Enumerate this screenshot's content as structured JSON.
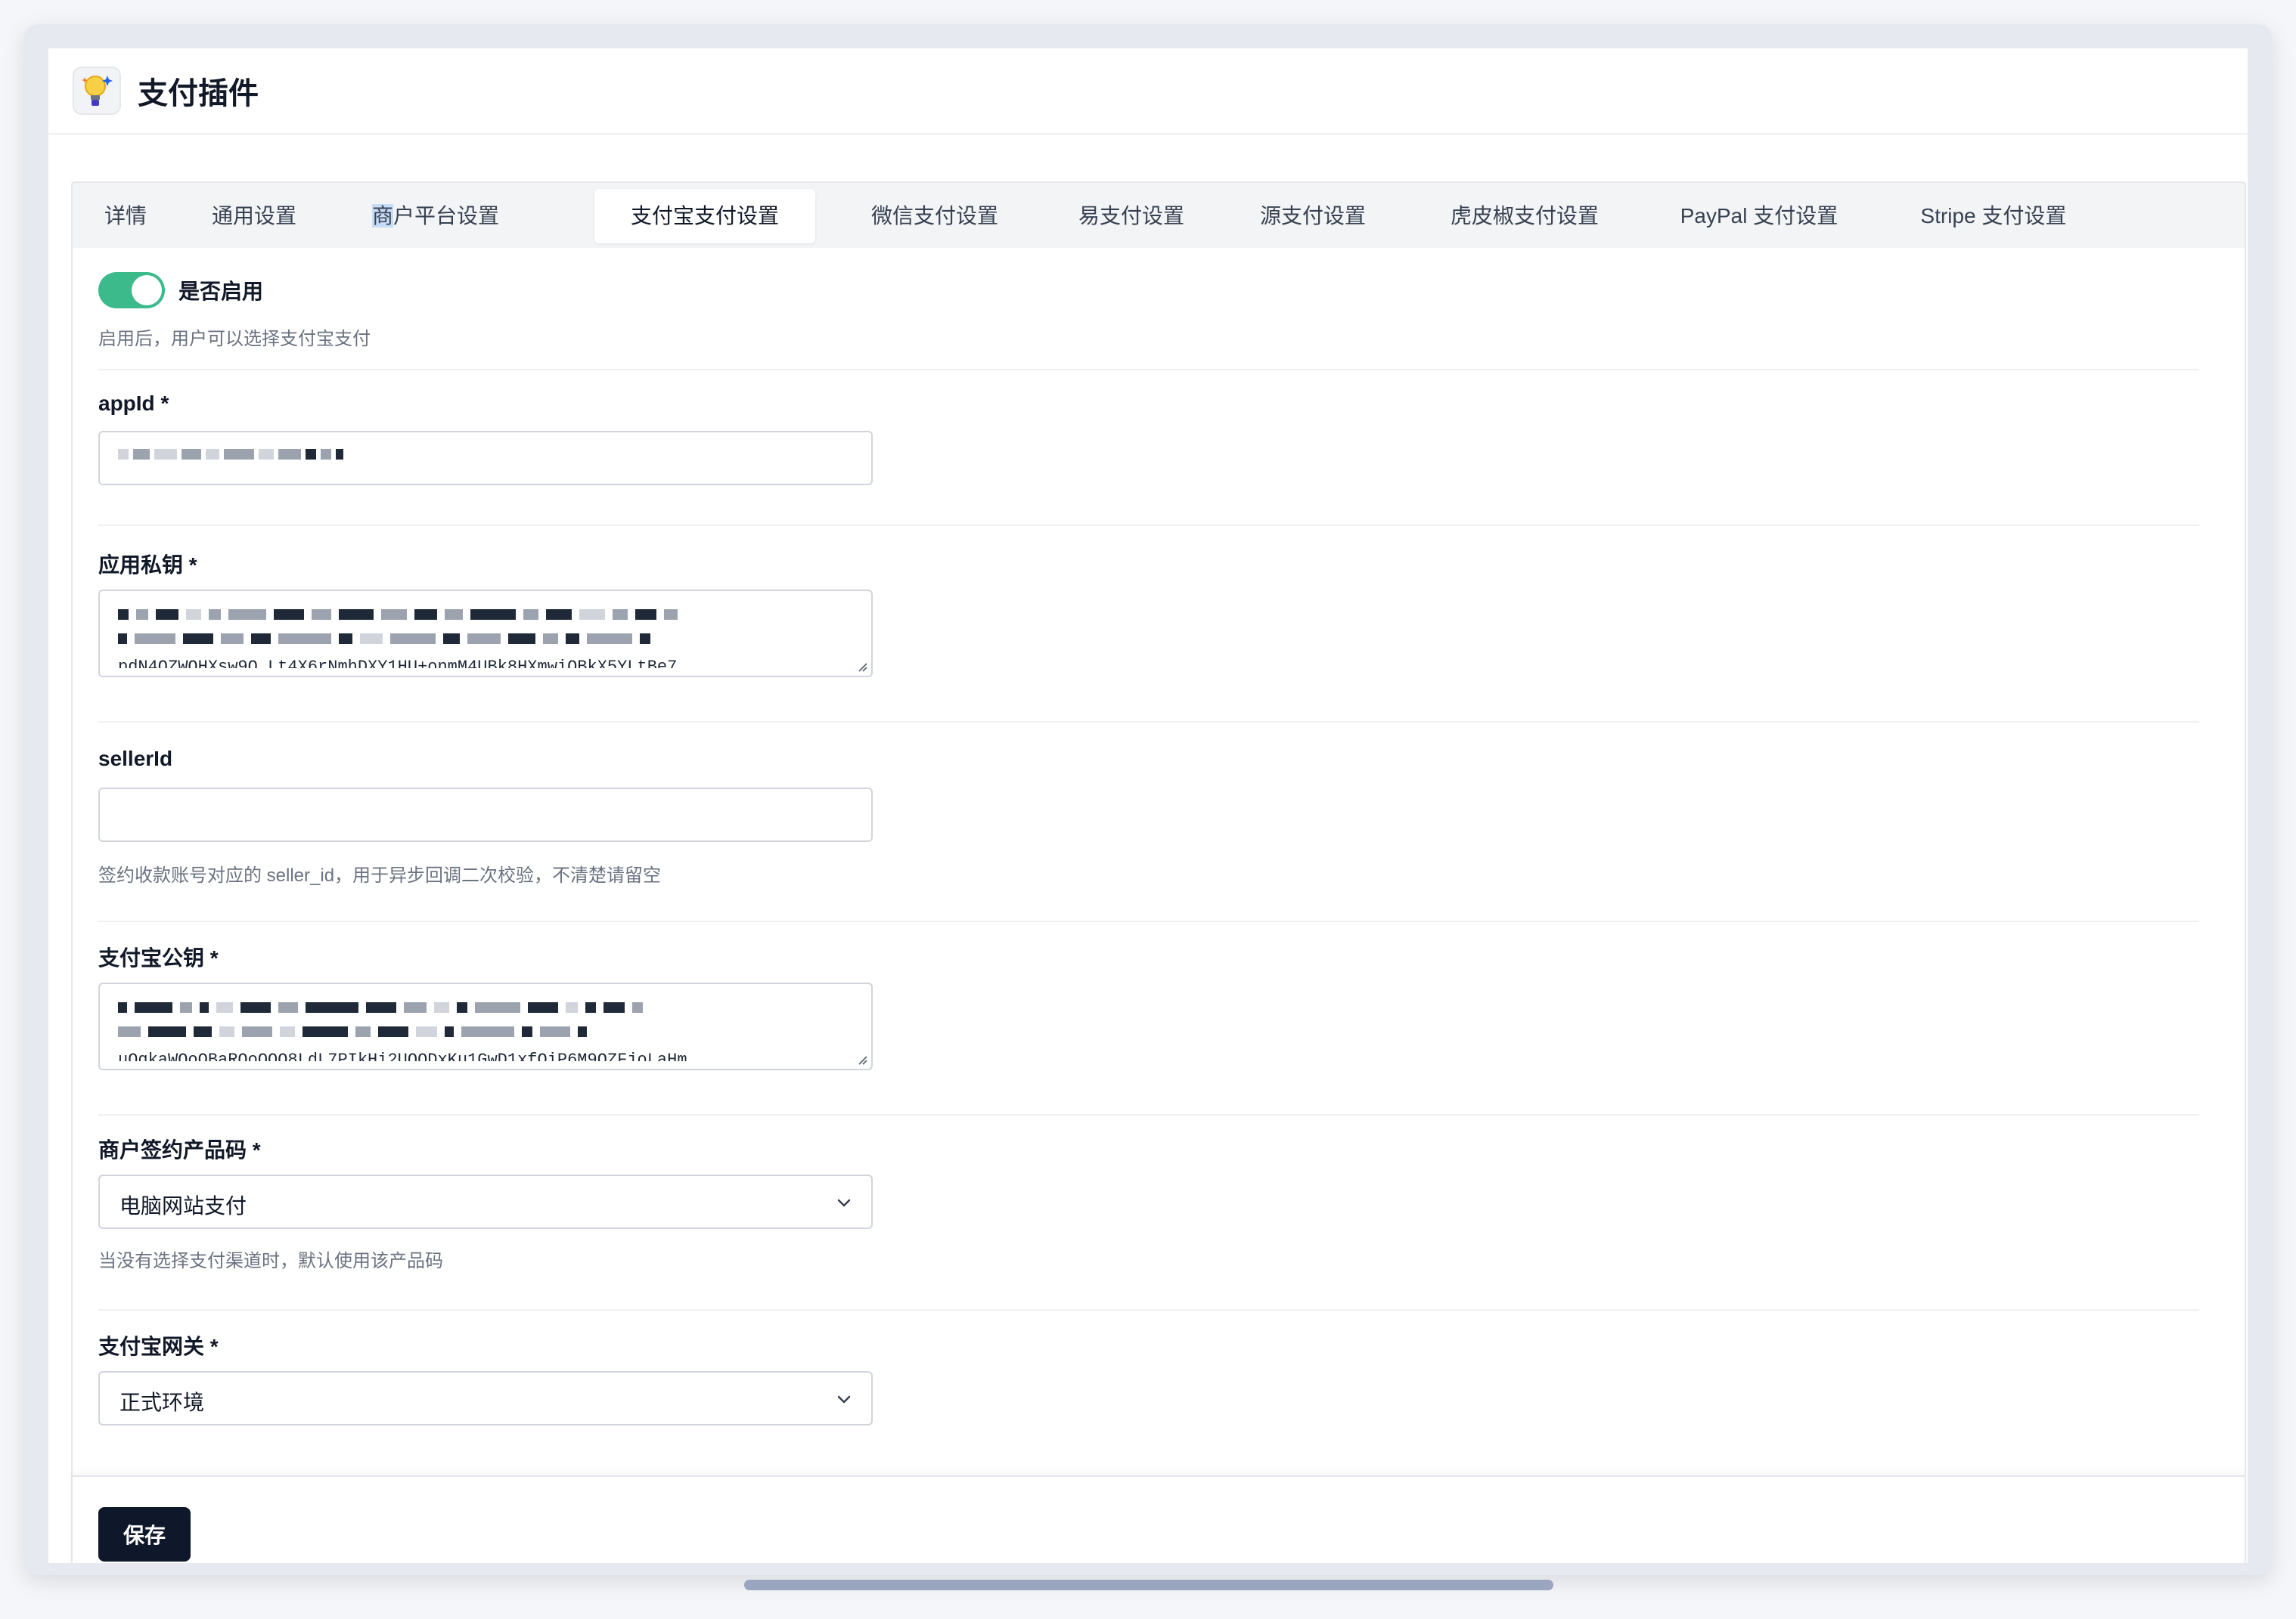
{
  "header": {
    "title": "支付插件"
  },
  "tabs": [
    {
      "label": "详情",
      "active": false
    },
    {
      "label": "通用设置",
      "active": false
    },
    {
      "label_highlight": "商",
      "label_rest": "户平台设置",
      "active": false
    },
    {
      "label": "支付宝支付设置",
      "active": true
    },
    {
      "label": "微信支付设置",
      "active": false
    },
    {
      "label": "易支付设置",
      "active": false
    },
    {
      "label": "源支付设置",
      "active": false
    },
    {
      "label": "虎皮椒支付设置",
      "active": false
    },
    {
      "label": "PayPal 支付设置",
      "active": false
    },
    {
      "label": "Stripe 支付设置",
      "active": false
    }
  ],
  "form": {
    "enable": {
      "label": "是否启用",
      "help": "启用后，用户可以选择支付宝支付",
      "enabled": true
    },
    "appid": {
      "label": "appId *"
    },
    "private_key": {
      "label": "应用私钥 *",
      "overflow_text": "pdN4QZWQHXsw9Q Lt4X6rNmhDXY1HU+onmM4UBk8HXmwiQBkX5YLtBe7"
    },
    "seller_id": {
      "label": "sellerId",
      "value": "",
      "help": "签约收款账号对应的 seller_id，用于异步回调二次校验，不清楚请留空"
    },
    "alipay_public_key": {
      "label": "支付宝公钥 *",
      "overflow_text": "uQqkaWQoOBaRQoOQQ8LdL7PIkHi2UQQDxKu1GwD1xfQiP6M9QZFjoLaHm"
    },
    "product_code": {
      "label": "商户签约产品码 *",
      "value": "电脑网站支付",
      "help": "当没有选择支付渠道时，默认使用该产品码"
    },
    "gateway": {
      "label": "支付宝网关 *",
      "value": "正式环境"
    }
  },
  "footer": {
    "save_label": "保存"
  },
  "colors": {
    "toggle_on": "#3dba8c",
    "primary_button": "#0f172a",
    "highlight": "#c7dcf7"
  },
  "icons": {
    "app": "bulb-icon",
    "select_arrow": "chevron-down-icon"
  }
}
